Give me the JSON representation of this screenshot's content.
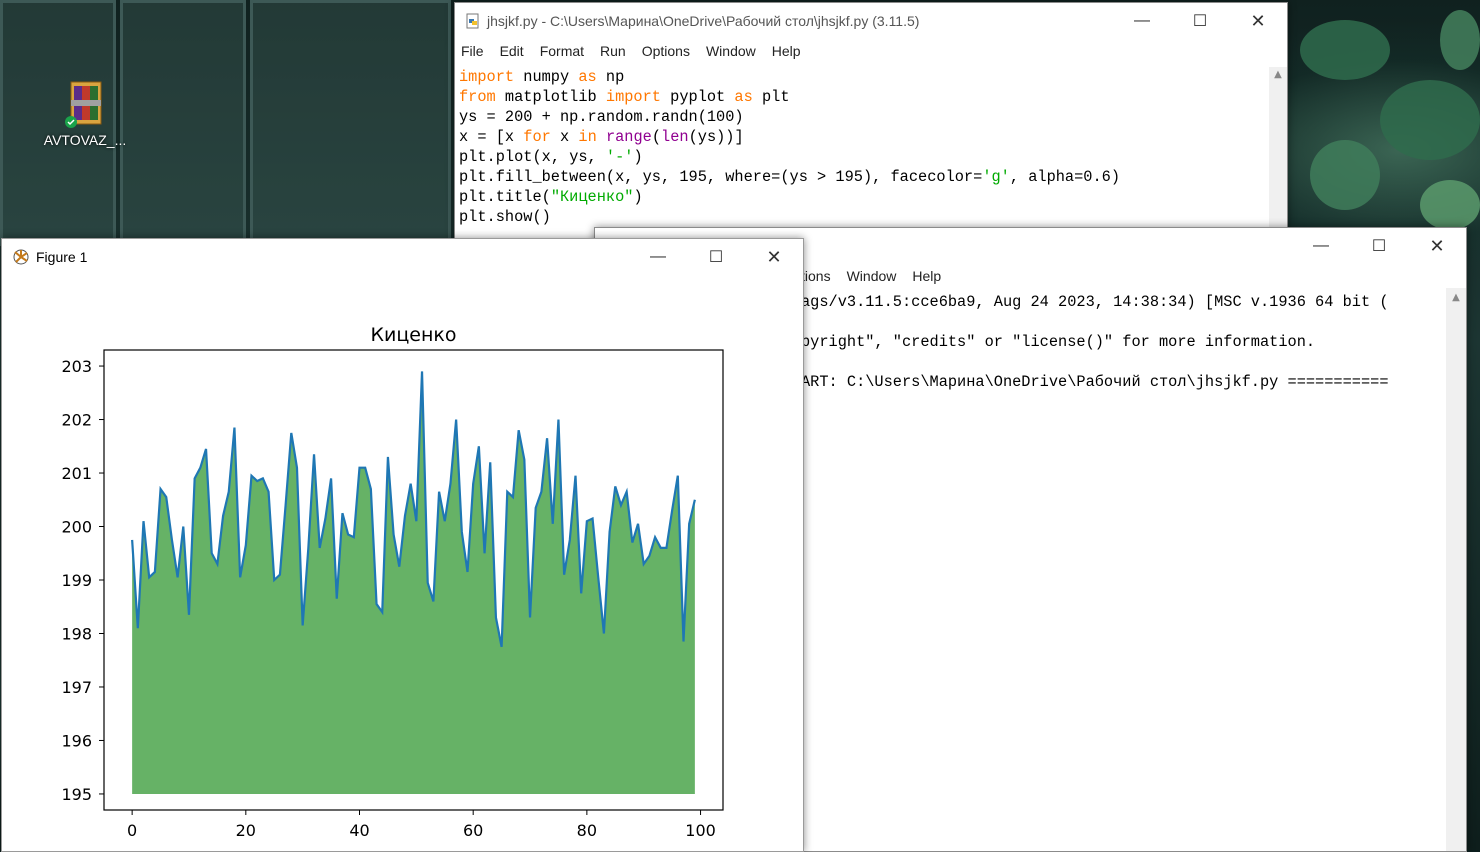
{
  "desktop": {
    "icon_label": "AVTOVAZ_..."
  },
  "editor": {
    "title": "jhsjkf.py - C:\\Users\\Марина\\OneDrive\\Рабочий стол\\jhsjkf.py (3.11.5)",
    "menu": [
      "File",
      "Edit",
      "Format",
      "Run",
      "Options",
      "Window",
      "Help"
    ],
    "code_lines": [
      "import numpy as np",
      "from matplotlib import pyplot as plt",
      "ys = 200 + np.random.randn(100)",
      "x = [x for x in range(len(ys))]",
      "plt.plot(x, ys, '-')",
      "plt.fill_between(x, ys, 195, where=(ys > 195), facecolor='g', alpha=0.6)",
      "plt.title(\"Киценко\")",
      "plt.show()"
    ]
  },
  "shell": {
    "menu": [
      "tions",
      "Window",
      "Help"
    ],
    "lines": [
      "ags/v3.11.5:cce6ba9, Aug 24 2023, 14:38:34) [MSC v.1936 64 bit (",
      "",
      "pyright\", \"credits\" or \"license()\" for more information.",
      "",
      "ART: C:\\Users\\Марина\\OneDrive\\Рабочий стол\\jhsjkf.py ==========="
    ]
  },
  "figure": {
    "title": "Figure 1"
  },
  "colors": {
    "fill": "#66b266",
    "line": "#1f77b4",
    "keyword": "#ff7700",
    "builtin": "#900090",
    "string": "#00aa00"
  },
  "chart_data": {
    "type": "area",
    "title": "Киценко",
    "xlabel": "",
    "ylabel": "",
    "xlim": [
      -4.95,
      103.95
    ],
    "ylim": [
      194.7,
      203.3
    ],
    "xticks": [
      0,
      20,
      40,
      60,
      80,
      100
    ],
    "yticks": [
      195,
      196,
      197,
      198,
      199,
      200,
      201,
      202,
      203
    ],
    "baseline": 195,
    "grid": false,
    "x": [
      0,
      1,
      2,
      3,
      4,
      5,
      6,
      7,
      8,
      9,
      10,
      11,
      12,
      13,
      14,
      15,
      16,
      17,
      18,
      19,
      20,
      21,
      22,
      23,
      24,
      25,
      26,
      27,
      28,
      29,
      30,
      31,
      32,
      33,
      34,
      35,
      36,
      37,
      38,
      39,
      40,
      41,
      42,
      43,
      44,
      45,
      46,
      47,
      48,
      49,
      50,
      51,
      52,
      53,
      54,
      55,
      56,
      57,
      58,
      59,
      60,
      61,
      62,
      63,
      64,
      65,
      66,
      67,
      68,
      69,
      70,
      71,
      72,
      73,
      74,
      75,
      76,
      77,
      78,
      79,
      80,
      81,
      82,
      83,
      84,
      85,
      86,
      87,
      88,
      89,
      90,
      91,
      92,
      93,
      94,
      95,
      96,
      97,
      98,
      99
    ],
    "values": [
      199.75,
      198.1,
      200.1,
      199.05,
      199.15,
      200.7,
      200.55,
      199.75,
      199.05,
      200.0,
      198.35,
      200.9,
      201.1,
      201.45,
      199.5,
      199.3,
      200.2,
      200.65,
      201.85,
      199.05,
      199.65,
      200.95,
      200.85,
      200.9,
      200.65,
      199.0,
      199.1,
      200.4,
      201.75,
      201.1,
      198.15,
      199.6,
      201.35,
      199.6,
      200.15,
      200.9,
      198.65,
      200.25,
      199.85,
      199.8,
      201.1,
      201.1,
      200.7,
      198.55,
      198.4,
      201.3,
      199.85,
      199.25,
      200.2,
      200.8,
      200.1,
      202.9,
      198.95,
      198.6,
      200.65,
      200.1,
      200.8,
      202.0,
      199.9,
      199.15,
      200.8,
      201.5,
      199.5,
      201.2,
      198.3,
      197.75,
      200.65,
      200.55,
      201.8,
      201.25,
      198.3,
      200.35,
      200.65,
      201.65,
      200.05,
      202.0,
      199.1,
      199.75,
      200.95,
      198.75,
      200.1,
      200.15,
      199.05,
      198.0,
      199.9,
      200.75,
      200.4,
      200.65,
      199.7,
      200.05,
      199.3,
      199.45,
      199.8,
      199.6,
      199.6,
      200.3,
      200.95,
      197.85,
      200.05,
      200.5
    ]
  }
}
